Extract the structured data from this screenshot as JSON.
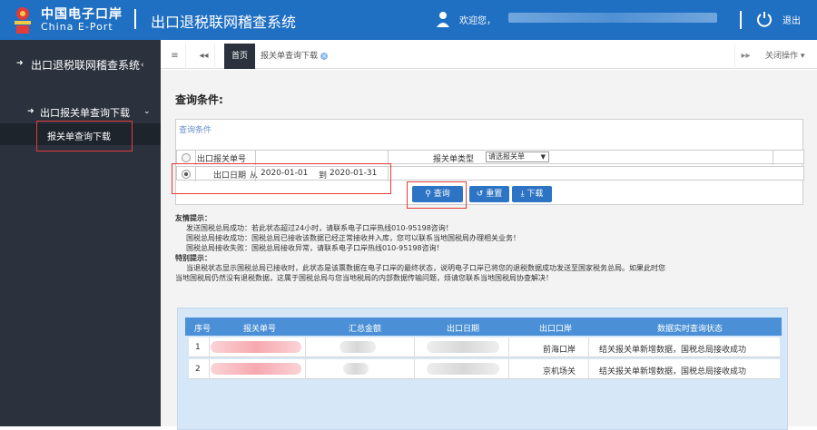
{
  "header": {
    "brand_cn": "中国电子口岸",
    "brand_en": "China E-Port",
    "app_title": "出口退税联网稽查系统",
    "welcome": "欢迎您，",
    "logout": "退出",
    "bg_color": "#1f6fc3"
  },
  "sidebar": {
    "group_label": "出口退税联网稽查系统",
    "sub_label": "出口报关单查询下载",
    "leaf_label": "报关单查询下载"
  },
  "tabs": {
    "home": "首页",
    "current": "报关单查询下载",
    "close_ops": "关闭操作"
  },
  "query": {
    "title": "查询条件:",
    "panel_title": "查询条件",
    "row1_label": "出口报关单号",
    "type_label": "报关单类型",
    "type_selected": "请选报关单",
    "row2_label": "出口日期",
    "from_label": "从",
    "from_date": "2020-01-01",
    "to_label": "到",
    "to_date": "2020-01-31",
    "btn_query": "查询",
    "btn_reset": "重置",
    "btn_download": "下载"
  },
  "tips": {
    "friendly_title": "友情提示：",
    "friendly": [
      "发送国税总局成功：若此状态超过24小时，请联系电子口岸热线010-95198咨询！",
      "国税总局接收成功：国税总局已接收该数据已经正常接收并入库，您可以联系当地国税局办理相关业务！",
      "国税总局接收失败：国税总局接收异常，请联系电子口岸热线010-95198咨询！"
    ],
    "special_title": "特别提示：",
    "special_1": "当退税状态显示国税总局已接收时，此状态是该票数据在电子口岸的最终状态，说明电子口岸已将您的退税数据成功发送至国家税务总局。如果此时您",
    "special_2": "当地国税局仍然没有退税数据，这属于国税总局与您当地税局的内部数据传输问题，烦请您联系当地国税局协查解决！"
  },
  "table": {
    "headers": [
      "序号",
      "报关单号",
      "汇总金额",
      "出口日期",
      "出口口岸",
      "数据实时查询状态"
    ],
    "rows": [
      {
        "no": "1",
        "port": "前海口岸",
        "status": "结关报关单新增数据，国税总局接收成功"
      },
      {
        "no": "2",
        "port": "京机场关",
        "status": "结关报关单新增数据，国税总局接收成功"
      }
    ]
  }
}
